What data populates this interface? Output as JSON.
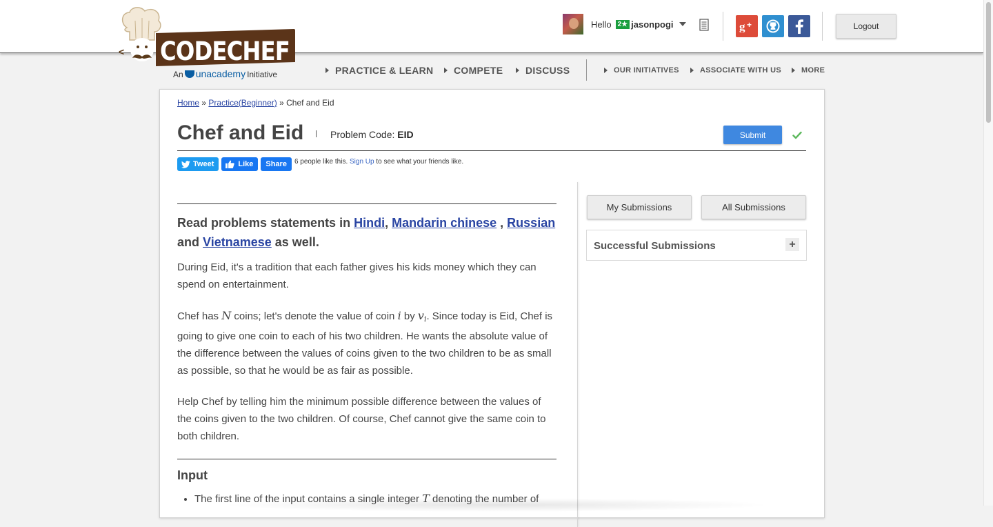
{
  "brand": {
    "name": "CODECHEF",
    "sub_prefix": "An",
    "sub_brand": "unacademy",
    "sub_suffix": "Initiative"
  },
  "user": {
    "greeting": "Hello",
    "badge": "2★",
    "username": "jasonpogi"
  },
  "header": {
    "logout_label": "Logout"
  },
  "nav": {
    "practice": "PRACTICE & LEARN",
    "compete": "COMPETE",
    "discuss": "DISCUSS",
    "initiatives": "OUR INITIATIVES",
    "associate": "ASSOCIATE WITH US",
    "more": "MORE"
  },
  "breadcrumb": {
    "home": "Home",
    "sep1": "»",
    "practice": "Practice(Beginner)",
    "sep2": "»",
    "current": "Chef and Eid"
  },
  "problem": {
    "title": "Chef and Eid",
    "code_label": "Problem Code:",
    "code": "EID",
    "submit_label": "Submit"
  },
  "share": {
    "tweet": "Tweet",
    "like": "Like",
    "share": "Share",
    "likes_text": "6 people like this.",
    "signup": "Sign Up",
    "likes_suffix": "to see what your friends like."
  },
  "statement": {
    "langs_prefix": "Read problems statements in",
    "hindi": "Hindi",
    "mandarin": "Mandarin chinese",
    "russian": "Russian",
    "and": "and",
    "vietnamese": "Vietnamese",
    "langs_suffix": "as well.",
    "p1": "During Eid, it's a tradition that each father gives his kids money which they can spend on entertainment.",
    "p2_a": "Chef has",
    "p2_N": "N",
    "p2_b": "coins; let's denote the value of coin",
    "p2_i": "i",
    "p2_c": "by",
    "p2_v": "v",
    "p2_vi": "i",
    "p2_d": ". Since today is Eid, Chef is going to give one coin to each of his two children. He wants the absolute value of the difference between the values of coins given to the two children to be as small as possible, so that he would be as fair as possible.",
    "p3": "Help Chef by telling him the minimum possible difference between the values of the coins given to the two children. Of course, Chef cannot give the same coin to both children.",
    "input_heading": "Input",
    "input_li1_a": "The first line of the input contains a single integer",
    "input_li1_T": "T",
    "input_li1_b": "denoting the number of"
  },
  "sidebar": {
    "my_submissions": "My Submissions",
    "all_submissions": "All Submissions",
    "successful_submissions": "Successful Submissions",
    "expand": "+"
  },
  "colors": {
    "submit_blue": "#3f88e0",
    "link_blue": "#2a45a3",
    "google_red": "#dd4b39",
    "github_blue": "#2f8fd0",
    "facebook_blue": "#3b5998",
    "check_green": "#5cb85c"
  },
  "icons": {
    "notes": "notebook-icon",
    "google": "google-plus-icon",
    "github": "github-icon",
    "facebook": "facebook-icon",
    "check": "checkmark-icon"
  }
}
